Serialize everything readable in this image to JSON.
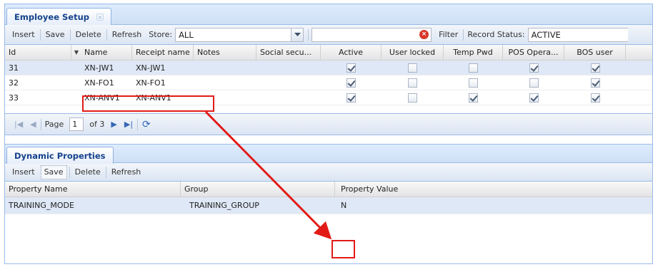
{
  "employee_panel": {
    "tab_title": "Employee Setup",
    "tab_close": "×",
    "toolbar": {
      "insert": "Insert",
      "save": "Save",
      "delete": "Delete",
      "refresh": "Refresh",
      "store_label": "Store:",
      "store_value": "ALL",
      "filter_value": "",
      "filter_label": "Filter",
      "record_status_label": "Record Status:",
      "record_status_value": "ACTIVE"
    },
    "columns": [
      "Id",
      "Name",
      "Receipt name",
      "Notes",
      "Social secu...",
      "Active",
      "User locked",
      "Temp Pwd",
      "POS Opera...",
      "BOS user"
    ],
    "rows": [
      {
        "id": "31",
        "name": "XN-JW1",
        "receipt_name": "XN-JW1",
        "notes": "",
        "social": "",
        "active": true,
        "user_locked": false,
        "temp_pwd": false,
        "pos_operator": true,
        "bos_user": true
      },
      {
        "id": "32",
        "name": "XN-FO1",
        "receipt_name": "XN-FO1",
        "notes": "",
        "social": "",
        "active": true,
        "user_locked": false,
        "temp_pwd": false,
        "pos_operator": false,
        "bos_user": true
      },
      {
        "id": "33",
        "name": "XN-ANV1",
        "receipt_name": "XN-ANV1",
        "notes": "",
        "social": "",
        "active": true,
        "user_locked": false,
        "temp_pwd": true,
        "pos_operator": true,
        "bos_user": true
      }
    ],
    "pager": {
      "page_label": "Page",
      "page_value": "1",
      "of_label": "of 3"
    }
  },
  "properties_panel": {
    "tab_title": "Dynamic Properties",
    "toolbar": {
      "insert": "Insert",
      "save": "Save",
      "delete": "Delete",
      "refresh": "Refresh"
    },
    "columns": [
      "Property Name",
      "Group",
      "Property Value"
    ],
    "rows": [
      {
        "property_name": "TRAINING_MODE",
        "group": "TRAINING_GROUP",
        "property_value": "N"
      }
    ]
  },
  "icons": {
    "first_page": "first-page-icon",
    "prev_page": "prev-page-icon",
    "next_page": "next-page-icon",
    "last_page": "last-page-icon",
    "refresh": "refresh-icon",
    "clear": "clear-filter-icon",
    "dropdown": "chevron-down-icon"
  },
  "colors": {
    "header_blue": "#15428b",
    "border_blue": "#99bbe8",
    "selected_row": "#dfe8f6",
    "annotation_red": "#e21b17"
  }
}
